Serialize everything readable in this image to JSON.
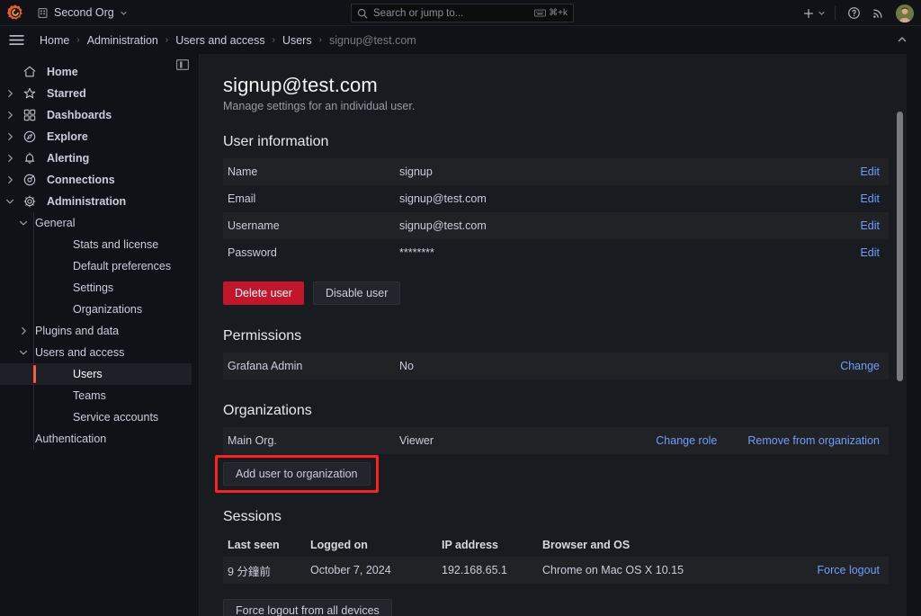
{
  "topbar": {
    "logo": "grafana-logo",
    "org_name": "Second Org",
    "search_placeholder": "Search or jump to...",
    "search_value": "",
    "search_shortcut": "⌘+k",
    "new_label": "+",
    "icons": [
      "plus-icon",
      "help-icon",
      "news-icon",
      "avatar"
    ]
  },
  "breadcrumb": {
    "items": [
      {
        "label": "Home",
        "current": false
      },
      {
        "label": "Administration",
        "current": false
      },
      {
        "label": "Users and access",
        "current": false
      },
      {
        "label": "Users",
        "current": false
      },
      {
        "label": "signup@test.com",
        "current": true
      }
    ],
    "separator": "›"
  },
  "sidebar": {
    "items": [
      {
        "label": "Home",
        "icon": "home-icon",
        "level": 1,
        "expandable": false,
        "expanded": false,
        "selected": false
      },
      {
        "label": "Starred",
        "icon": "star-icon",
        "level": 1,
        "expandable": true,
        "expanded": false,
        "selected": false
      },
      {
        "label": "Dashboards",
        "icon": "dashboards-icon",
        "level": 1,
        "expandable": true,
        "expanded": false,
        "selected": false
      },
      {
        "label": "Explore",
        "icon": "compass-icon",
        "level": 1,
        "expandable": true,
        "expanded": false,
        "selected": false
      },
      {
        "label": "Alerting",
        "icon": "bell-icon",
        "level": 1,
        "expandable": true,
        "expanded": false,
        "selected": false
      },
      {
        "label": "Connections",
        "icon": "connections-icon",
        "level": 1,
        "expandable": true,
        "expanded": false,
        "selected": false
      },
      {
        "label": "Administration",
        "icon": "gear-icon",
        "level": 1,
        "expandable": true,
        "expanded": true,
        "selected": false
      },
      {
        "label": "General",
        "icon": "",
        "level": 2,
        "expandable": true,
        "expanded": true,
        "selected": false
      },
      {
        "label": "Stats and license",
        "icon": "",
        "level": 3,
        "expandable": false,
        "expanded": false,
        "selected": false
      },
      {
        "label": "Default preferences",
        "icon": "",
        "level": 3,
        "expandable": false,
        "expanded": false,
        "selected": false
      },
      {
        "label": "Settings",
        "icon": "",
        "level": 3,
        "expandable": false,
        "expanded": false,
        "selected": false
      },
      {
        "label": "Organizations",
        "icon": "",
        "level": 3,
        "expandable": false,
        "expanded": false,
        "selected": false
      },
      {
        "label": "Plugins and data",
        "icon": "",
        "level": 2,
        "expandable": true,
        "expanded": false,
        "selected": false
      },
      {
        "label": "Users and access",
        "icon": "",
        "level": 2,
        "expandable": true,
        "expanded": true,
        "selected": false
      },
      {
        "label": "Users",
        "icon": "",
        "level": 3,
        "expandable": false,
        "expanded": false,
        "selected": true
      },
      {
        "label": "Teams",
        "icon": "",
        "level": 3,
        "expandable": false,
        "expanded": false,
        "selected": false
      },
      {
        "label": "Service accounts",
        "icon": "",
        "level": 3,
        "expandable": false,
        "expanded": false,
        "selected": false
      },
      {
        "label": "Authentication",
        "icon": "",
        "level": 2,
        "expandable": false,
        "expanded": false,
        "selected": false
      }
    ],
    "dock_icon": "dock-panel-icon"
  },
  "page": {
    "title": "signup@test.com",
    "subtitle": "Manage settings for an individual user."
  },
  "user_information": {
    "heading": "User information",
    "rows": [
      {
        "label": "Name",
        "value": "signup",
        "action": "Edit"
      },
      {
        "label": "Email",
        "value": "signup@test.com",
        "action": "Edit"
      },
      {
        "label": "Username",
        "value": "signup@test.com",
        "action": "Edit"
      },
      {
        "label": "Password",
        "value": "********",
        "action": "Edit"
      }
    ],
    "delete_label": "Delete user",
    "disable_label": "Disable user"
  },
  "permissions": {
    "heading": "Permissions",
    "rows": [
      {
        "label": "Grafana Admin",
        "value": "No",
        "action": "Change"
      }
    ]
  },
  "organizations": {
    "heading": "Organizations",
    "rows": [
      {
        "name": "Main Org.",
        "role": "Viewer",
        "change_label": "Change role",
        "remove_label": "Remove from organization"
      }
    ],
    "add_label": "Add user to organization",
    "highlight_color": "#ff2020"
  },
  "sessions": {
    "heading": "Sessions",
    "columns": [
      "Last seen",
      "Logged on",
      "IP address",
      "Browser and OS"
    ],
    "rows": [
      {
        "last_seen": "9 分鐘前",
        "logged_on": "October 7, 2024",
        "ip": "192.168.65.1",
        "browser": "Chrome on Mac OS X 10.15",
        "action": "Force logout"
      }
    ],
    "logout_all_label": "Force logout from all devices"
  },
  "colors": {
    "accent": "#f55f3e",
    "link": "#6e9fff",
    "danger": "#c4162a",
    "panel": "#181b1f",
    "chrome": "#111217"
  }
}
